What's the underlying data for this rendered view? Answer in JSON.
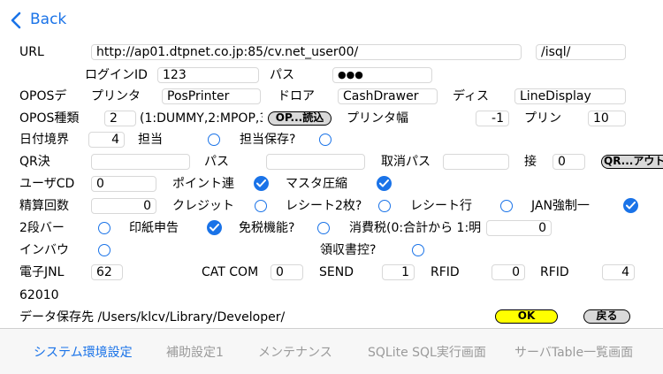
{
  "nav": {
    "back_label": "Back"
  },
  "url": {
    "label": "URL",
    "value": "http://ap01.dtpnet.co.jp:85/cv.net_user00/",
    "suffix": "/isql/"
  },
  "login": {
    "id_label": "ログインID",
    "id_value": "123",
    "pass_label": "パス",
    "pass_value": "●●●"
  },
  "opos": {
    "label": "OPOSデ",
    "printer_label": "プリンタ",
    "printer_value": "PosPrinter",
    "drawer_label": "ドロア",
    "drawer_value": "CashDrawer",
    "display_label": "ディス",
    "display_value": "LineDisplay"
  },
  "opos_type": {
    "label": "OPOS種類",
    "value": "2",
    "hint": "(1:DUMMY,2:MPOP,3",
    "qr_button": "OP...読込",
    "width_label": "プリンタ幅",
    "width_value": "-1",
    "print_label": "プリン",
    "print_value": "10"
  },
  "date": {
    "label": "日付境界",
    "value": "4",
    "staff_label": "担当",
    "staff_save_label": "担当保存?"
  },
  "qr": {
    "label": "QR決",
    "pass_label": "パス",
    "cancel_pass_label": "取消パス",
    "conn_label": "接",
    "conn_value": "0",
    "out_button": "QR...アウト"
  },
  "user": {
    "label": "ユーザCD",
    "value": "0",
    "point_label": "ポイント連",
    "master_label": "マスタ圧縮"
  },
  "settle": {
    "label": "精算回数",
    "value": "0",
    "credit_label": "クレジット",
    "receipt2_label": "レシート2枚?",
    "receipt_line_label": "レシート行",
    "jan_label": "JAN強制一"
  },
  "row2": {
    "bar_label": "2段バー",
    "stamp_label": "印紙申告",
    "tax_free_label": "免税機能?",
    "tax_label": "消費税(0:合計から 1:明",
    "tax_value": "0"
  },
  "inbound": {
    "label": "インバウ",
    "receipt_label": "領収書控?"
  },
  "jnl": {
    "label": "電子JNL",
    "value": "62",
    "catcom_label": "CAT COM",
    "catcom_value": "0",
    "send_label": "SEND",
    "send_value": "1",
    "rfid1_label": "RFID",
    "rfid1_value": "0",
    "rfid2_label": "RFID",
    "rfid2_value": "4"
  },
  "version": "62010",
  "save_path": {
    "label": "データ保存先 /Users/klcv/Library/Developer/",
    "ok_label": "OK",
    "back_label": "戻る"
  },
  "tabs": [
    {
      "label": "システム環境設定"
    },
    {
      "label": "補助設定1"
    },
    {
      "label": "メンテナンス"
    },
    {
      "label": "SQLite SQL実行画面"
    },
    {
      "label": "サーバTable一覧画面"
    }
  ],
  "colors": {
    "accent": "#1a73e8",
    "ok": "#ffff00",
    "tab_inactive": "#9a9a9a"
  }
}
